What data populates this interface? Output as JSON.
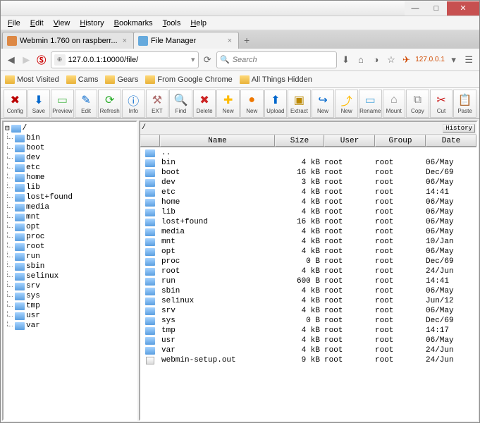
{
  "menubar": [
    "File",
    "Edit",
    "View",
    "History",
    "Bookmarks",
    "Tools",
    "Help"
  ],
  "tabs": [
    {
      "label": "Webmin 1.760 on raspberr...",
      "active": false
    },
    {
      "label": "File Manager",
      "active": true
    }
  ],
  "url": "127.0.0.1:10000/file/",
  "search_placeholder": "Search",
  "ip_badge": "127.0.0.1",
  "bookmarks": [
    "Most Visited",
    "Cams",
    "Gears",
    "From Google Chrome",
    "All Things Hidden"
  ],
  "toolbar": [
    {
      "l": "Config",
      "c": "#b00",
      "g": "✖"
    },
    {
      "l": "Save",
      "c": "#06c",
      "g": "⬇"
    },
    {
      "l": "Preview",
      "c": "#5b5",
      "g": "▭"
    },
    {
      "l": "Edit",
      "c": "#06c",
      "g": "✎"
    },
    {
      "l": "Refresh",
      "c": "#2a2",
      "g": "⟳"
    },
    {
      "l": "Info",
      "c": "#06c",
      "g": "ⓘ"
    },
    {
      "l": "EXT",
      "c": "#a66",
      "g": "⚒"
    },
    {
      "l": "Find",
      "c": "#888",
      "g": "🔍"
    },
    {
      "l": "Delete",
      "c": "#c22",
      "g": "✖"
    },
    {
      "l": "New",
      "c": "#fb0",
      "g": "✚"
    },
    {
      "l": "New",
      "c": "#e70",
      "g": "●"
    },
    {
      "l": "Upload",
      "c": "#06c",
      "g": "⬆"
    },
    {
      "l": "Extract",
      "c": "#b80",
      "g": "▣"
    },
    {
      "l": "New",
      "c": "#06c",
      "g": "↪"
    },
    {
      "l": "New",
      "c": "#fb0",
      "g": "⤴"
    },
    {
      "l": "Rename",
      "c": "#5ad",
      "g": "▭"
    },
    {
      "l": "Mount",
      "c": "#888",
      "g": "⌂"
    },
    {
      "l": "Copy",
      "c": "#888",
      "g": "⧉"
    },
    {
      "l": "Cut",
      "c": "#c22",
      "g": "✂"
    },
    {
      "l": "Paste",
      "c": "#b80",
      "g": "📋"
    }
  ],
  "tree_root": "/",
  "tree": [
    "bin",
    "boot",
    "dev",
    "etc",
    "home",
    "lib",
    "lost+found",
    "media",
    "mnt",
    "opt",
    "proc",
    "root",
    "run",
    "sbin",
    "selinux",
    "srv",
    "sys",
    "tmp",
    "usr",
    "var"
  ],
  "path": "/",
  "history_label": "History",
  "columns": [
    "",
    "Name",
    "Size",
    "User",
    "Group",
    "Date"
  ],
  "parent_label": "..",
  "files": [
    {
      "n": "bin",
      "s": "4 kB",
      "u": "root",
      "g": "root",
      "d": "06/May",
      "t": "d"
    },
    {
      "n": "boot",
      "s": "16 kB",
      "u": "root",
      "g": "root",
      "d": "Dec/69",
      "t": "d"
    },
    {
      "n": "dev",
      "s": "3 kB",
      "u": "root",
      "g": "root",
      "d": "06/May",
      "t": "d"
    },
    {
      "n": "etc",
      "s": "4 kB",
      "u": "root",
      "g": "root",
      "d": "14:41",
      "t": "d"
    },
    {
      "n": "home",
      "s": "4 kB",
      "u": "root",
      "g": "root",
      "d": "06/May",
      "t": "d"
    },
    {
      "n": "lib",
      "s": "4 kB",
      "u": "root",
      "g": "root",
      "d": "06/May",
      "t": "d"
    },
    {
      "n": "lost+found",
      "s": "16 kB",
      "u": "root",
      "g": "root",
      "d": "06/May",
      "t": "d"
    },
    {
      "n": "media",
      "s": "4 kB",
      "u": "root",
      "g": "root",
      "d": "06/May",
      "t": "d"
    },
    {
      "n": "mnt",
      "s": "4 kB",
      "u": "root",
      "g": "root",
      "d": "10/Jan",
      "t": "d"
    },
    {
      "n": "opt",
      "s": "4 kB",
      "u": "root",
      "g": "root",
      "d": "06/May",
      "t": "d"
    },
    {
      "n": "proc",
      "s": "0 B",
      "u": "root",
      "g": "root",
      "d": "Dec/69",
      "t": "d"
    },
    {
      "n": "root",
      "s": "4 kB",
      "u": "root",
      "g": "root",
      "d": "24/Jun",
      "t": "d"
    },
    {
      "n": "run",
      "s": "600 B",
      "u": "root",
      "g": "root",
      "d": "14:41",
      "t": "d"
    },
    {
      "n": "sbin",
      "s": "4 kB",
      "u": "root",
      "g": "root",
      "d": "06/May",
      "t": "d"
    },
    {
      "n": "selinux",
      "s": "4 kB",
      "u": "root",
      "g": "root",
      "d": "Jun/12",
      "t": "d"
    },
    {
      "n": "srv",
      "s": "4 kB",
      "u": "root",
      "g": "root",
      "d": "06/May",
      "t": "d"
    },
    {
      "n": "sys",
      "s": "0 B",
      "u": "root",
      "g": "root",
      "d": "Dec/69",
      "t": "d"
    },
    {
      "n": "tmp",
      "s": "4 kB",
      "u": "root",
      "g": "root",
      "d": "14:17",
      "t": "d"
    },
    {
      "n": "usr",
      "s": "4 kB",
      "u": "root",
      "g": "root",
      "d": "06/May",
      "t": "d"
    },
    {
      "n": "var",
      "s": "4 kB",
      "u": "root",
      "g": "root",
      "d": "24/Jun",
      "t": "d"
    },
    {
      "n": "webmin-setup.out",
      "s": "9 kB",
      "u": "root",
      "g": "root",
      "d": "24/Jun",
      "t": "f"
    }
  ]
}
